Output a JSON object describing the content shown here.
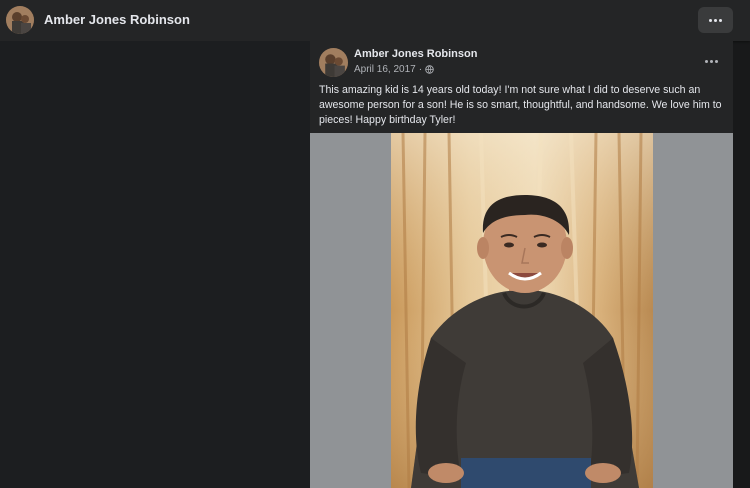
{
  "header": {
    "profile_name": "Amber Jones Robinson",
    "avatar_icon": "profile-photo-avatar",
    "more_icon": "more-horizontal-icon"
  },
  "post": {
    "author": "Amber Jones Robinson",
    "date": "April 16, 2017",
    "separator": "·",
    "privacy_icon": "globe-icon",
    "caption": "This amazing kid is 14 years old today! I'm not sure what I did to deserve such an awesome person for a son! He is so smart, thoughtful, and handsome. We love him to pieces! Happy birthday Tyler!",
    "photo_subject": "teen-boy-portrait-cornfield"
  },
  "colors": {
    "page_bg": "#18191a",
    "bar_bg": "#242526",
    "photo_matte": "#909396",
    "text_primary": "#e4e6eb",
    "text_secondary": "#b0b3b8"
  }
}
